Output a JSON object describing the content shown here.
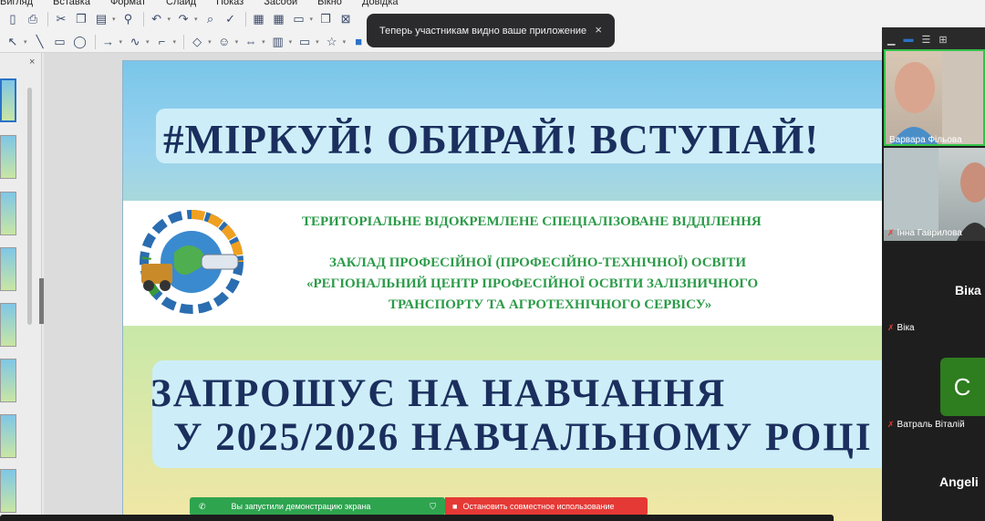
{
  "menu": [
    "Вигляд",
    "Вставка",
    "Формат",
    "Слайд",
    "Показ",
    "Засоби",
    "Вікно",
    "Довідка"
  ],
  "notification": {
    "text": "Теперь участникам видно ваше приложение",
    "close": "×"
  },
  "slide": {
    "title": "#МІРКУЙ! ОБИРАЙ! ВСТУПАЙ!",
    "org_lines": [
      "ТЕРИТОРІАЛЬНЕ ВІДОКРЕМЛЕНЕ СПЕЦІАЛІЗОВАНЕ ВІДДІЛЕННЯ",
      "ЗАКЛАД ПРОФЕСІЙНОЇ (ПРОФЕСІЙНО-ТЕХНІЧНОЇ) ОСВІТИ",
      "«РЕГІОНАЛЬНИЙ ЦЕНТР ПРОФЕСІЙНОЇ ОСВІТИ ЗАЛІЗНИЧНОГО",
      "ТРАНСПОРТУ ТА АГРОТЕХНІЧНОГО СЕРВІСУ»"
    ],
    "invite_line1": "ЗАПРОШУЄ НА НАВЧАННЯ",
    "invite_line2": "У 2025/2026 НАВЧАЛЬНОМУ РОЦІ"
  },
  "share": {
    "status": "Вы запустили демонстрацию экрана",
    "stop": "Остановить совместное использование"
  },
  "participants": [
    {
      "name": "Варвара Фільова",
      "muted": false
    },
    {
      "name": "Інна Гаврилова",
      "muted": true
    },
    {
      "name": "Віка",
      "muted": true,
      "display": "Віка"
    },
    {
      "name": "Ватраль Віталій",
      "muted": true,
      "avatar_letter": "С"
    },
    {
      "name": "Angelina",
      "display": "Angeli",
      "muted": false
    }
  ],
  "colors": {
    "title": "#1b2f5e",
    "org_text": "#2b9a48",
    "share_green": "#2ea44f",
    "share_red": "#e53935"
  }
}
